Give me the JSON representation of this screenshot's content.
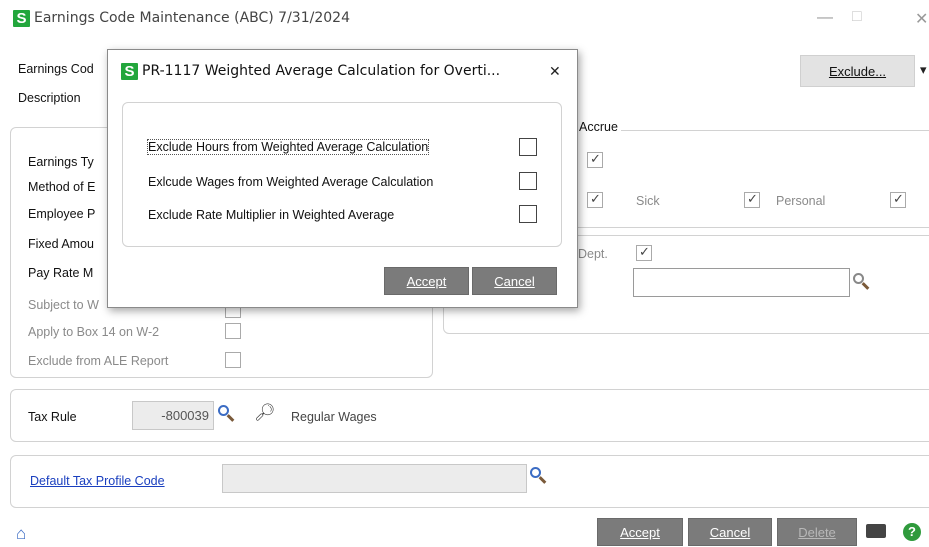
{
  "window": {
    "logo_letter": "S",
    "title": "Earnings Code Maintenance (ABC) 7/31/2024",
    "minimize": "—",
    "maximize": "□",
    "close": "✕"
  },
  "main": {
    "earnings_code_label": "Earnings Cod",
    "description_label": "Description",
    "exclude_button": "Exclude...",
    "exclude_dropdown": "▾",
    "left_panel": {
      "labels": [
        "Earnings Ty",
        "Method of E",
        "Employee P",
        "Fixed Amou",
        "Pay Rate M"
      ],
      "subject_to": "Subject to W",
      "apply_box14": "Apply to Box 14 on W-2",
      "exclude_ale": "Exclude from ALE Report"
    },
    "accrue": {
      "title": "Accrue",
      "sick": "Sick",
      "personal": "Personal",
      "dept": "Dept."
    },
    "tax_rule": {
      "label": "Tax Rule",
      "value": "-800039",
      "description": "Regular Wages"
    },
    "tax_profile": {
      "link": "Default Tax Profile Code"
    },
    "buttons": {
      "accept": "Accept",
      "cancel": "Cancel",
      "delete": "Delete"
    }
  },
  "dialog": {
    "logo_letter": "S",
    "title": "PR-1117 Weighted Average Calculation for Overti...",
    "close": "✕",
    "options": [
      {
        "label": "Exclude Hours from Weighted Average Calculation",
        "checked": false
      },
      {
        "label": "Exlcude Wages from Weighted Average Calculation",
        "checked": false
      },
      {
        "label": "Exclude Rate Multiplier in Weighted Average",
        "checked": false
      }
    ],
    "accept": "Accept",
    "cancel": "Cancel"
  }
}
